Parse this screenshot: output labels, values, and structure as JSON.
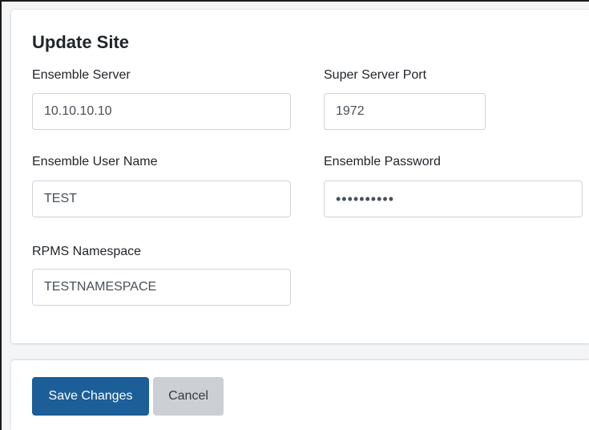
{
  "form": {
    "title": "Update Site",
    "fields": {
      "ensemble_server": {
        "label": "Ensemble Server",
        "value": "10.10.10.10"
      },
      "super_server_port": {
        "label": "Super Server Port",
        "value": "1972"
      },
      "ensemble_user_name": {
        "label": "Ensemble User Name",
        "value": "TEST"
      },
      "ensemble_password": {
        "label": "Ensemble Password",
        "value": "••••••••••"
      },
      "rpms_namespace": {
        "label": "RPMS Namespace",
        "value": "TESTNAMESPACE"
      }
    }
  },
  "footer": {
    "save_label": "Save Changes",
    "cancel_label": "Cancel"
  },
  "colors": {
    "primary": "#1b5e98",
    "secondary": "#ccd0d5",
    "background": "#f4f5f7",
    "input_border": "#ced4da"
  }
}
